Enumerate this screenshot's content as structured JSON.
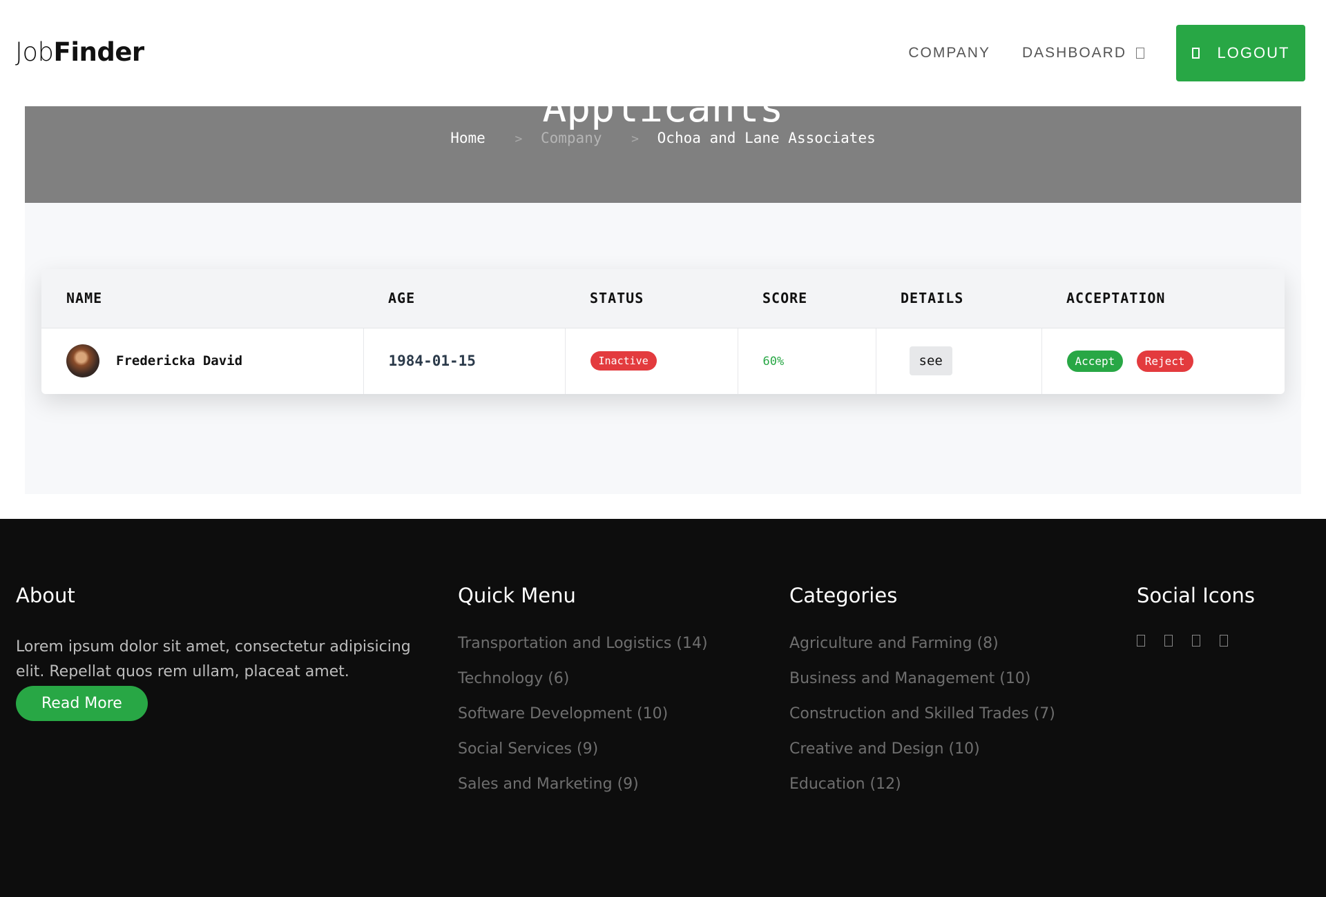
{
  "header": {
    "logo_light": "Job",
    "logo_bold": "Finder",
    "nav": {
      "company": "COMPANY",
      "dashboard": "DASHBOARD",
      "logout": "LOGOUT"
    }
  },
  "hero": {
    "title": "Applicants",
    "breadcrumb": {
      "home": "Home",
      "company": "Company",
      "current": "Ochoa and Lane Associates"
    }
  },
  "table": {
    "columns": [
      "NAME",
      "AGE",
      "STATUS",
      "SCORE",
      "DETAILS",
      "ACCEPTATION"
    ],
    "rows": [
      {
        "name": "Fredericka David",
        "age": "1984-01-15",
        "status": "Inactive",
        "score": "60%",
        "details": "see",
        "accept": "Accept",
        "reject": "Reject"
      }
    ]
  },
  "footer": {
    "about": {
      "title": "About",
      "text": "Lorem ipsum dolor sit amet, consectetur adipisicing elit. Repellat quos rem ullam, placeat amet.",
      "button": "Read More"
    },
    "quick_menu": {
      "title": "Quick Menu",
      "items": [
        "Transportation and Logistics (14)",
        "Technology (6)",
        "Software Development (10)",
        "Social Services (9)",
        "Sales and Marketing (9)"
      ]
    },
    "categories": {
      "title": "Categories",
      "items": [
        "Agriculture and Farming (8)",
        "Business and Management (10)",
        "Construction and Skilled Trades (7)",
        "Creative and Design (10)",
        "Education (12)"
      ]
    },
    "social": {
      "title": "Social Icons",
      "icons": [
        "facebook-icon",
        "twitter-icon",
        "instagram-icon",
        "linkedin-icon"
      ]
    }
  },
  "colors": {
    "accent": "#28a745",
    "danger": "#e33b3e",
    "hero_bg": "#808080",
    "footer_bg": "#0d0d0d"
  }
}
